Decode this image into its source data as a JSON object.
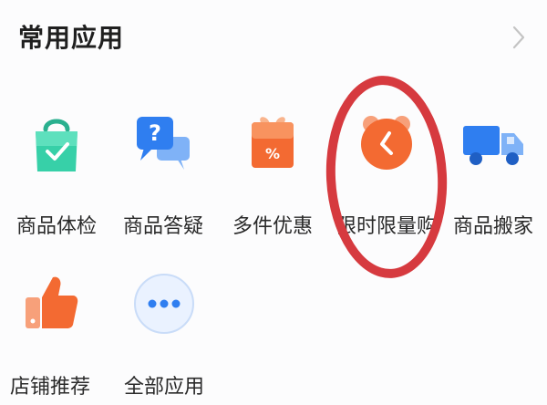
{
  "section": {
    "title": "常用应用"
  },
  "apps": [
    {
      "label": "商品体检",
      "icon": "shopping-bag-check-icon"
    },
    {
      "label": "商品答疑",
      "icon": "question-chat-bubbles-icon"
    },
    {
      "label": "多件优惠",
      "icon": "percent-gift-box-icon"
    },
    {
      "label": "限时限量购",
      "icon": "alarm-clock-icon"
    },
    {
      "label": "商品搬家",
      "icon": "delivery-truck-icon"
    },
    {
      "label": "店铺推荐",
      "icon": "thumbs-up-icon"
    },
    {
      "label": "全部应用",
      "icon": "more-dots-icon"
    }
  ],
  "colors": {
    "green": "#2fc4a0",
    "blue": "#2f7ef0",
    "orange": "#f36a32",
    "ring_red": "#d63a3f"
  }
}
